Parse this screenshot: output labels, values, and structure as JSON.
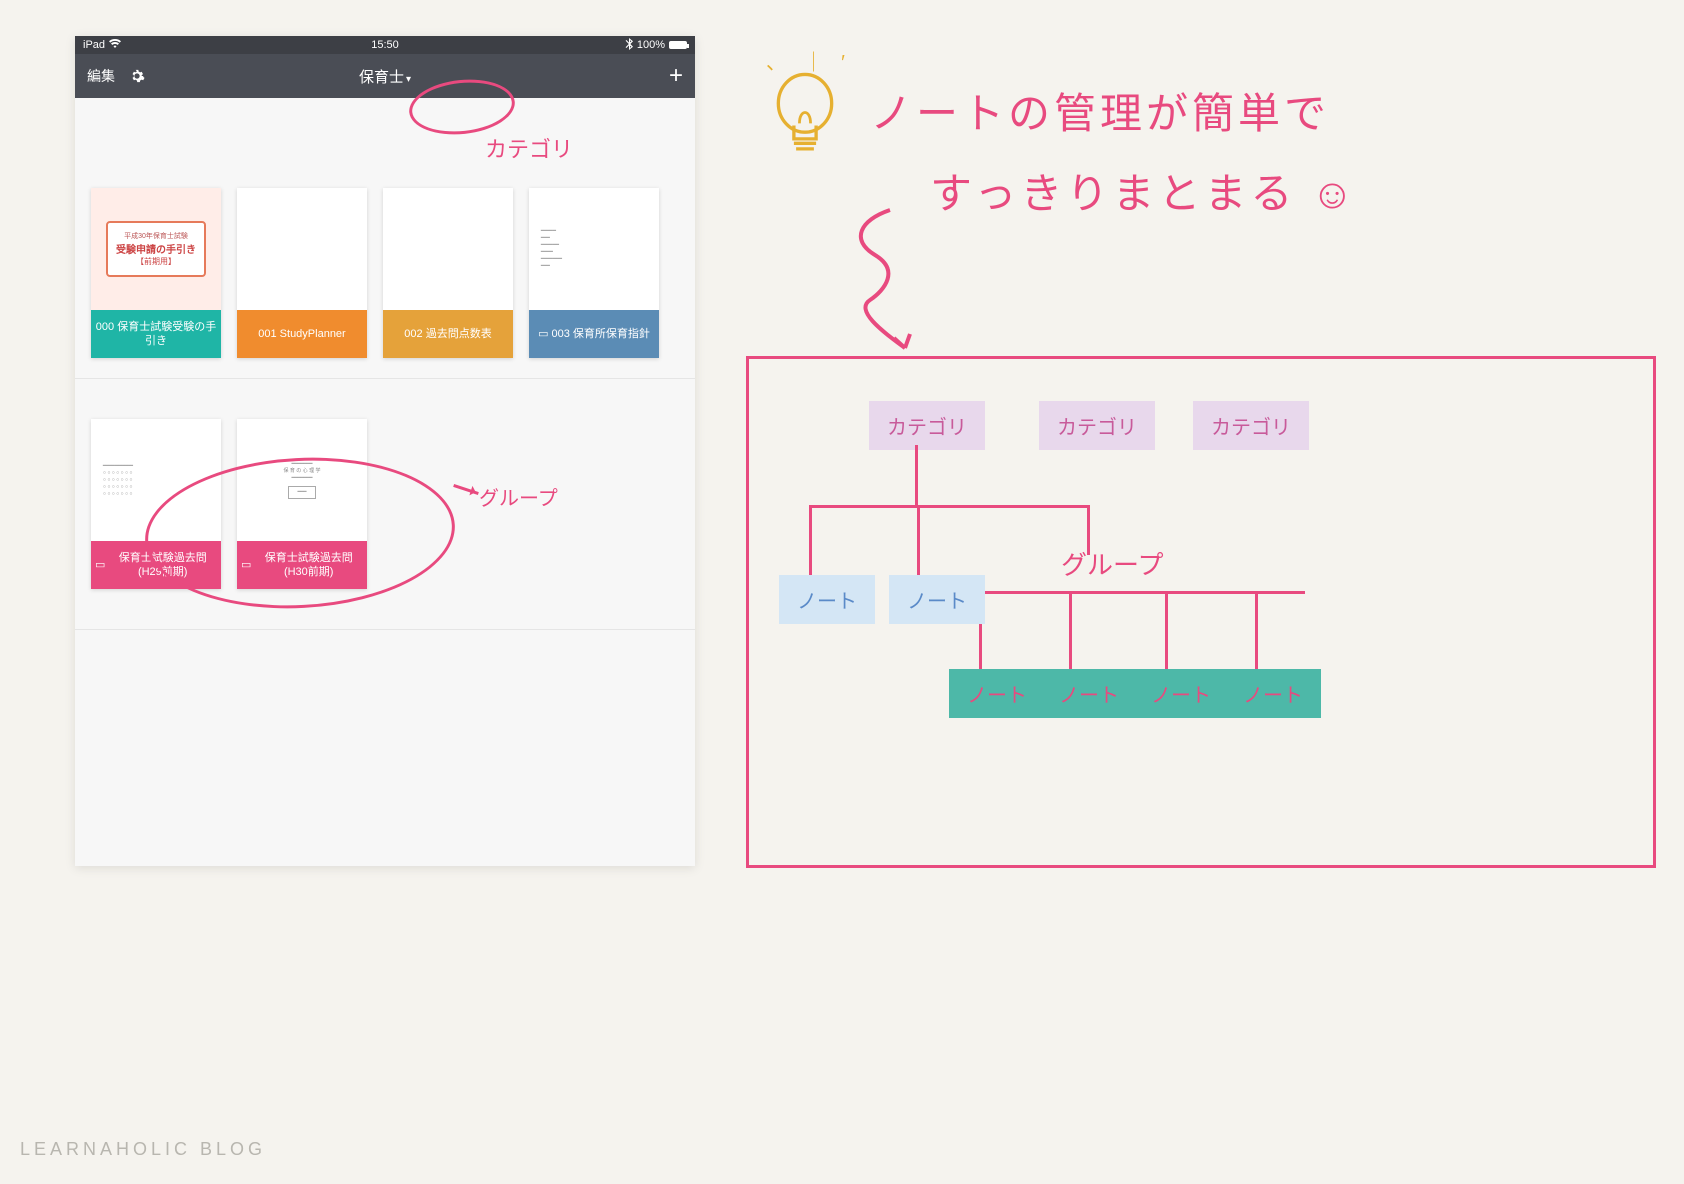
{
  "statusbar": {
    "device": "iPad",
    "time": "15:50",
    "battery_pct": "100%"
  },
  "toolbar": {
    "edit": "編集",
    "title": "保育士",
    "add": "+"
  },
  "notes_row1": [
    {
      "label": "000 保育士試験受験の手引き",
      "cover_line1": "平成30年保育士試験",
      "cover_line2": "受験申請の手引き",
      "cover_line3": "【前期用】"
    },
    {
      "label": "001 StudyPlanner"
    },
    {
      "label": "002 過去問点数表"
    },
    {
      "label": "003 保育所保育指針",
      "folder": true
    }
  ],
  "notes_row2": [
    {
      "label": "保育士試験過去問(H29前期)",
      "folder": true
    },
    {
      "label": "保育士試験過去問(H30前期)",
      "folder": true
    }
  ],
  "annotations": {
    "category": "カテゴリ",
    "group": "グループ",
    "headline1": "ノートの管理が簡単で",
    "headline2": "すっきりまとまる ☺"
  },
  "diagram": {
    "categories": [
      "カテゴリ",
      "カテゴリ",
      "カテゴリ"
    ],
    "group_label": "グループ",
    "blue_notes": [
      "ノート",
      "ノート"
    ],
    "teal_notes": [
      "ノート",
      "ノート",
      "ノート",
      "ノート"
    ]
  },
  "watermark": "LEARNAHOLIC BLOG"
}
